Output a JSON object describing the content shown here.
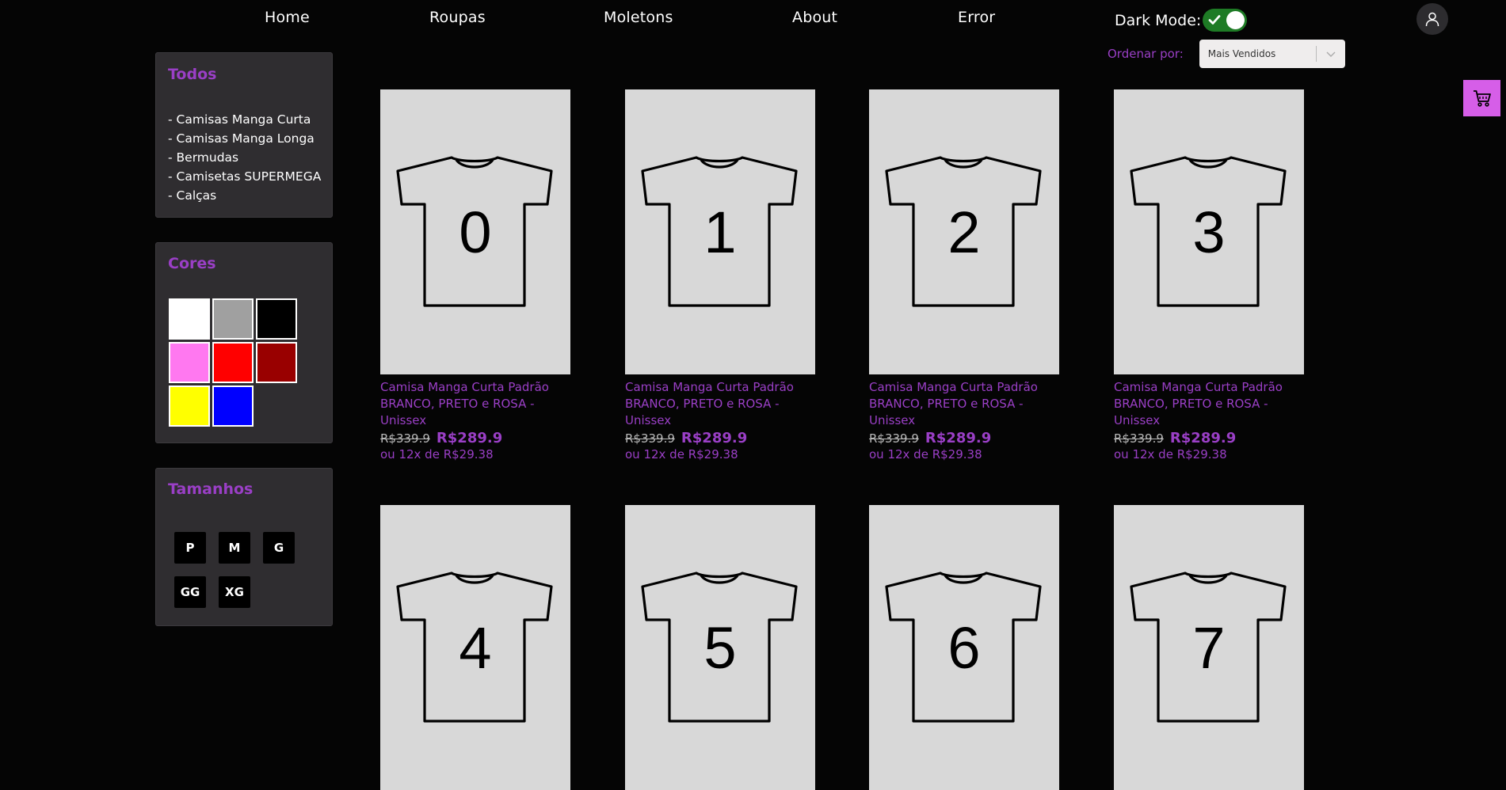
{
  "nav": {
    "items": [
      "Home",
      "Roupas",
      "Moletons",
      "About",
      "Error"
    ],
    "dark_mode_label": "Dark Mode:",
    "dark_mode_on": true
  },
  "sort": {
    "label": "Ordenar por:",
    "selected": "Mais Vendidos"
  },
  "sidebar": {
    "categories_title": "Todos",
    "categories": [
      "- Camisas Manga Curta",
      "- Camisas Manga Longa",
      "- Bermudas",
      "- Camisetas SUPERMEGA",
      "- Calças"
    ],
    "colors_title": "Cores",
    "colors": [
      "#ffffff",
      "#a0a0a0",
      "#000000",
      "#ff78f0",
      "#ff0000",
      "#990000",
      "#ffff00",
      "#0000ff"
    ],
    "sizes_title": "Tamanhos",
    "sizes": [
      "P",
      "M",
      "G",
      "GG",
      "XG"
    ]
  },
  "products": [
    {
      "number": "0",
      "title": "Camisa Manga Curta Padrão BRANCO, PRETO e ROSA - Unissex",
      "old_price": "R$339.9",
      "price": "R$289.9",
      "installments": "ou 12x de R$29.38"
    },
    {
      "number": "1",
      "title": "Camisa Manga Curta Padrão BRANCO, PRETO e ROSA - Unissex",
      "old_price": "R$339.9",
      "price": "R$289.9",
      "installments": "ou 12x de R$29.38"
    },
    {
      "number": "2",
      "title": "Camisa Manga Curta Padrão BRANCO, PRETO e ROSA - Unissex",
      "old_price": "R$339.9",
      "price": "R$289.9",
      "installments": "ou 12x de R$29.38"
    },
    {
      "number": "3",
      "title": "Camisa Manga Curta Padrão BRANCO, PRETO e ROSA - Unissex",
      "old_price": "R$339.9",
      "price": "R$289.9",
      "installments": "ou 12x de R$29.38"
    },
    {
      "number": "4"
    },
    {
      "number": "5"
    },
    {
      "number": "6"
    },
    {
      "number": "7"
    }
  ],
  "icons": {
    "toggle": "check-icon",
    "user": "user-icon",
    "cart": "cart-icon",
    "sort": "chevron-down-icon"
  },
  "colors": {
    "accent": "#9a3fc6",
    "cart_bg": "#d65ee8",
    "toggle_on": "#1e7b25",
    "panel_bg": "#2f2d30",
    "page_bg": "#050505"
  }
}
